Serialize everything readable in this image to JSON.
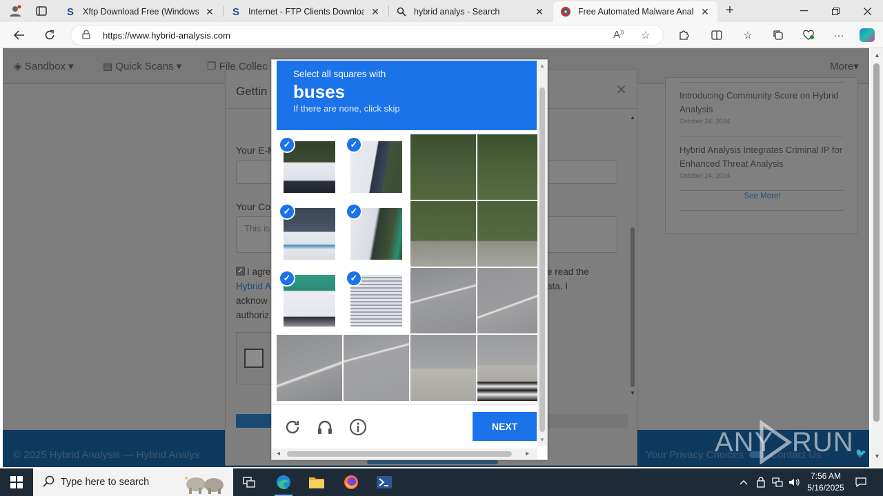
{
  "browser": {
    "tabs": [
      {
        "title": "Xftp Download Free (Windows) -",
        "icon": "softpedia-icon"
      },
      {
        "title": "Internet - FTP Clients Downloads",
        "icon": "softpedia-icon"
      },
      {
        "title": "hybrid analys - Search",
        "icon": "search-icon"
      },
      {
        "title": "Free Automated Malware Analysi",
        "icon": "hybrid-analysis-icon",
        "active": true
      }
    ],
    "url": "https://www.hybrid-analysis.com"
  },
  "site": {
    "nav": {
      "sandbox": "Sandbox",
      "quick_scans": "Quick Scans",
      "file_collections": "File Collec",
      "more": "More"
    },
    "news": [
      {
        "title": "Introducing Community Score on Hybrid Analysis",
        "date": "October 24, 2024"
      },
      {
        "title": "Hybrid Analysis Integrates Criminal IP for Enhanced Threat Analysis",
        "date": "October 24, 2024"
      }
    ],
    "see_more": "See More!",
    "footer_left": "© 2025 Hybrid Analysis — Hybrid Analys",
    "footer_right": "Your Privacy Choices",
    "footer_contact": "Contact Us",
    "watermark_any": "ANY",
    "watermark_run": "RUN"
  },
  "modal": {
    "title": "Gettin",
    "email_label": "Your E-M",
    "comment_label": "Your Co",
    "comment_placeholder": "This is",
    "agree_line1_a": "I agre",
    "agree_line1_b": "e read the",
    "agree_line2_link": "Hybrid A",
    "agree_line2_b": "ata. I",
    "agree_line3": "acknow",
    "agree_line4": "authoriz"
  },
  "captcha": {
    "instruction": "Select all squares with",
    "target": "buses",
    "hint": "If there are none, click skip",
    "next_label": "NEXT",
    "selected_tiles": [
      0,
      1,
      4,
      5,
      8,
      9
    ]
  },
  "taskbar": {
    "search_placeholder": "Type here to search",
    "time": "7:56 AM",
    "date": "5/16/2025"
  },
  "colors": {
    "accent": "#1a73e8",
    "footer": "#0f3a5f"
  }
}
